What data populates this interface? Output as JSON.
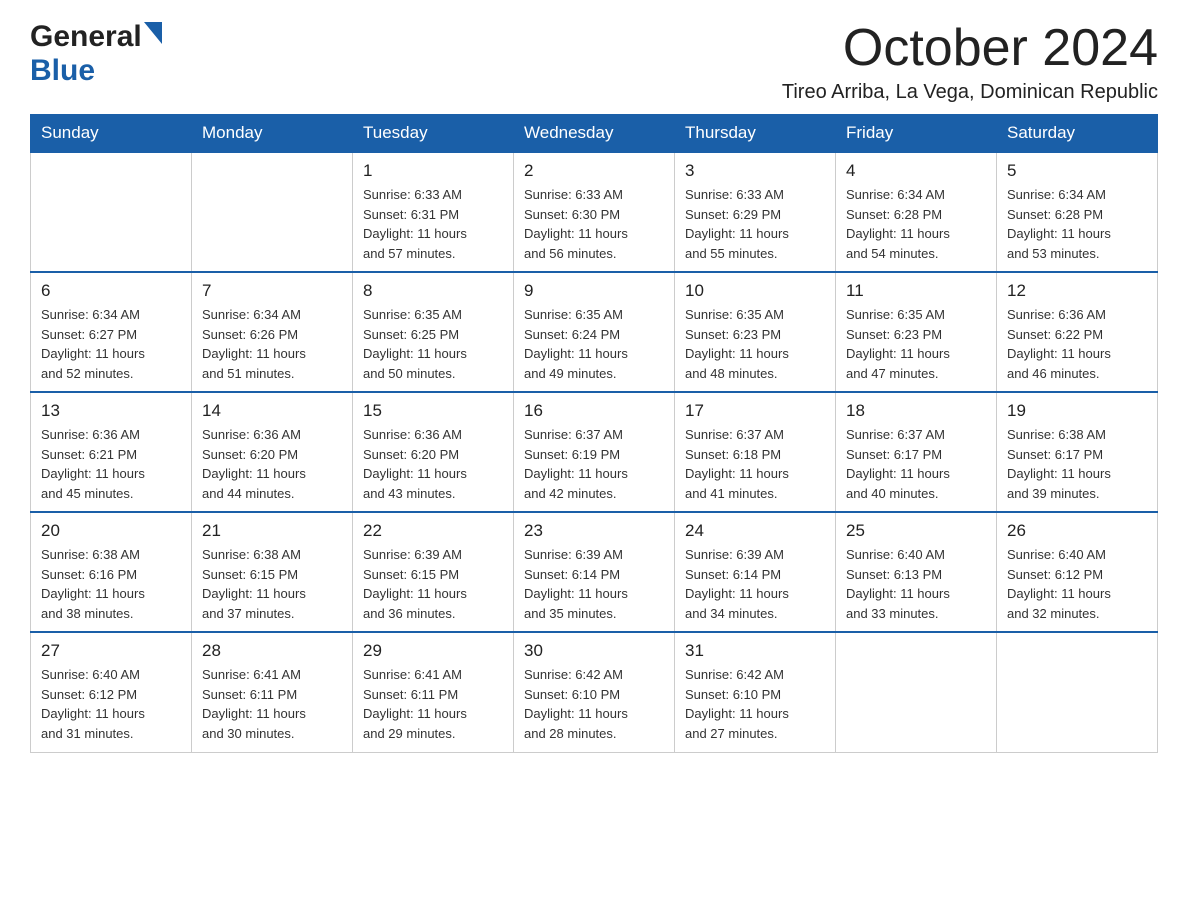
{
  "header": {
    "month_title": "October 2024",
    "location": "Tireo Arriba, La Vega, Dominican Republic",
    "logo_general": "General",
    "logo_blue": "Blue"
  },
  "weekdays": [
    "Sunday",
    "Monday",
    "Tuesday",
    "Wednesday",
    "Thursday",
    "Friday",
    "Saturday"
  ],
  "weeks": [
    [
      {
        "day": "",
        "info": ""
      },
      {
        "day": "",
        "info": ""
      },
      {
        "day": "1",
        "info": "Sunrise: 6:33 AM\nSunset: 6:31 PM\nDaylight: 11 hours\nand 57 minutes."
      },
      {
        "day": "2",
        "info": "Sunrise: 6:33 AM\nSunset: 6:30 PM\nDaylight: 11 hours\nand 56 minutes."
      },
      {
        "day": "3",
        "info": "Sunrise: 6:33 AM\nSunset: 6:29 PM\nDaylight: 11 hours\nand 55 minutes."
      },
      {
        "day": "4",
        "info": "Sunrise: 6:34 AM\nSunset: 6:28 PM\nDaylight: 11 hours\nand 54 minutes."
      },
      {
        "day": "5",
        "info": "Sunrise: 6:34 AM\nSunset: 6:28 PM\nDaylight: 11 hours\nand 53 minutes."
      }
    ],
    [
      {
        "day": "6",
        "info": "Sunrise: 6:34 AM\nSunset: 6:27 PM\nDaylight: 11 hours\nand 52 minutes."
      },
      {
        "day": "7",
        "info": "Sunrise: 6:34 AM\nSunset: 6:26 PM\nDaylight: 11 hours\nand 51 minutes."
      },
      {
        "day": "8",
        "info": "Sunrise: 6:35 AM\nSunset: 6:25 PM\nDaylight: 11 hours\nand 50 minutes."
      },
      {
        "day": "9",
        "info": "Sunrise: 6:35 AM\nSunset: 6:24 PM\nDaylight: 11 hours\nand 49 minutes."
      },
      {
        "day": "10",
        "info": "Sunrise: 6:35 AM\nSunset: 6:23 PM\nDaylight: 11 hours\nand 48 minutes."
      },
      {
        "day": "11",
        "info": "Sunrise: 6:35 AM\nSunset: 6:23 PM\nDaylight: 11 hours\nand 47 minutes."
      },
      {
        "day": "12",
        "info": "Sunrise: 6:36 AM\nSunset: 6:22 PM\nDaylight: 11 hours\nand 46 minutes."
      }
    ],
    [
      {
        "day": "13",
        "info": "Sunrise: 6:36 AM\nSunset: 6:21 PM\nDaylight: 11 hours\nand 45 minutes."
      },
      {
        "day": "14",
        "info": "Sunrise: 6:36 AM\nSunset: 6:20 PM\nDaylight: 11 hours\nand 44 minutes."
      },
      {
        "day": "15",
        "info": "Sunrise: 6:36 AM\nSunset: 6:20 PM\nDaylight: 11 hours\nand 43 minutes."
      },
      {
        "day": "16",
        "info": "Sunrise: 6:37 AM\nSunset: 6:19 PM\nDaylight: 11 hours\nand 42 minutes."
      },
      {
        "day": "17",
        "info": "Sunrise: 6:37 AM\nSunset: 6:18 PM\nDaylight: 11 hours\nand 41 minutes."
      },
      {
        "day": "18",
        "info": "Sunrise: 6:37 AM\nSunset: 6:17 PM\nDaylight: 11 hours\nand 40 minutes."
      },
      {
        "day": "19",
        "info": "Sunrise: 6:38 AM\nSunset: 6:17 PM\nDaylight: 11 hours\nand 39 minutes."
      }
    ],
    [
      {
        "day": "20",
        "info": "Sunrise: 6:38 AM\nSunset: 6:16 PM\nDaylight: 11 hours\nand 38 minutes."
      },
      {
        "day": "21",
        "info": "Sunrise: 6:38 AM\nSunset: 6:15 PM\nDaylight: 11 hours\nand 37 minutes."
      },
      {
        "day": "22",
        "info": "Sunrise: 6:39 AM\nSunset: 6:15 PM\nDaylight: 11 hours\nand 36 minutes."
      },
      {
        "day": "23",
        "info": "Sunrise: 6:39 AM\nSunset: 6:14 PM\nDaylight: 11 hours\nand 35 minutes."
      },
      {
        "day": "24",
        "info": "Sunrise: 6:39 AM\nSunset: 6:14 PM\nDaylight: 11 hours\nand 34 minutes."
      },
      {
        "day": "25",
        "info": "Sunrise: 6:40 AM\nSunset: 6:13 PM\nDaylight: 11 hours\nand 33 minutes."
      },
      {
        "day": "26",
        "info": "Sunrise: 6:40 AM\nSunset: 6:12 PM\nDaylight: 11 hours\nand 32 minutes."
      }
    ],
    [
      {
        "day": "27",
        "info": "Sunrise: 6:40 AM\nSunset: 6:12 PM\nDaylight: 11 hours\nand 31 minutes."
      },
      {
        "day": "28",
        "info": "Sunrise: 6:41 AM\nSunset: 6:11 PM\nDaylight: 11 hours\nand 30 minutes."
      },
      {
        "day": "29",
        "info": "Sunrise: 6:41 AM\nSunset: 6:11 PM\nDaylight: 11 hours\nand 29 minutes."
      },
      {
        "day": "30",
        "info": "Sunrise: 6:42 AM\nSunset: 6:10 PM\nDaylight: 11 hours\nand 28 minutes."
      },
      {
        "day": "31",
        "info": "Sunrise: 6:42 AM\nSunset: 6:10 PM\nDaylight: 11 hours\nand 27 minutes."
      },
      {
        "day": "",
        "info": ""
      },
      {
        "day": "",
        "info": ""
      }
    ]
  ]
}
